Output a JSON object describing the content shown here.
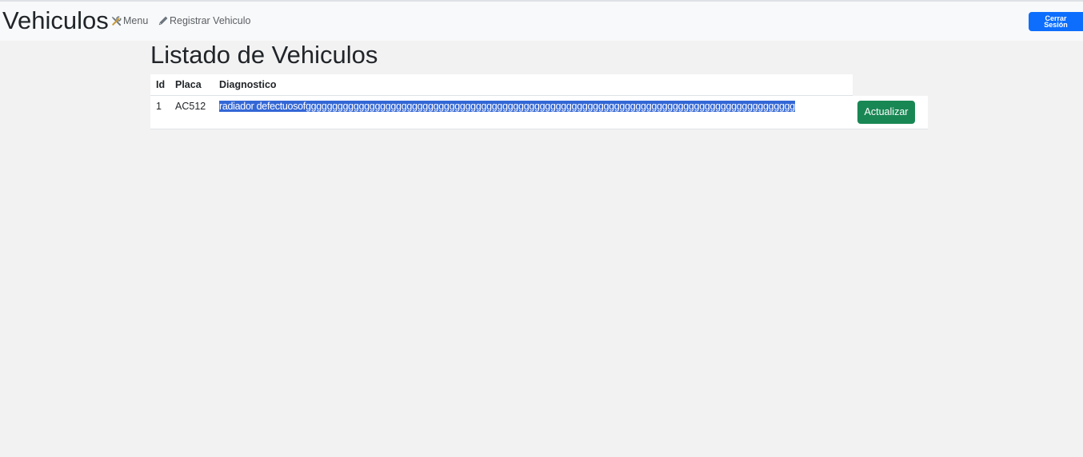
{
  "navbar": {
    "brand": "Vehiculos",
    "links": [
      {
        "label": "Menu",
        "icon": "tools-icon"
      },
      {
        "label": "Registrar Vehiculo",
        "icon": "pencil-icon"
      }
    ],
    "logout": {
      "line1": "Cerrar",
      "line2": "Sesión"
    }
  },
  "page": {
    "title": "Listado de Vehiculos"
  },
  "table": {
    "headers": [
      "Id",
      "Placa",
      "Diagnostico"
    ],
    "rows": [
      {
        "id": "1",
        "placa": "AC512",
        "diagnostico": "radiador defectuosofgggggggggggggggggggggggggggggggggggggggggggggggggggggggggggggggggggggggggggggggggggggggggggg",
        "action_label": "Actualizar"
      }
    ]
  },
  "colors": {
    "primary": "#0d6efd",
    "success": "#198754",
    "selection": "#3367d6",
    "navbar_bg": "#f8f9fa",
    "page_bg": "#f2f2f2"
  }
}
